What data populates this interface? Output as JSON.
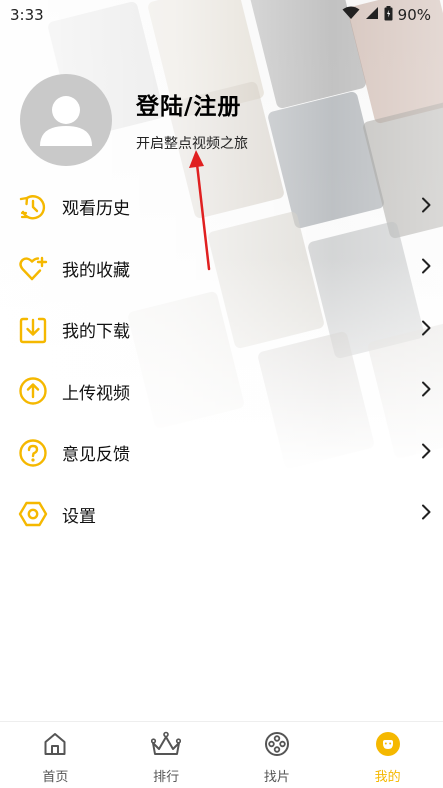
{
  "status_bar": {
    "time": "3:33",
    "battery": "90%"
  },
  "profile": {
    "title": "登陆/注册",
    "subtitle": "开启整点视频之旅"
  },
  "menu": {
    "items": [
      {
        "label": "观看历史",
        "icon": "history-icon"
      },
      {
        "label": "我的收藏",
        "icon": "heart-plus-icon"
      },
      {
        "label": "我的下载",
        "icon": "download-icon"
      },
      {
        "label": "上传视频",
        "icon": "upload-icon"
      },
      {
        "label": "意见反馈",
        "icon": "question-icon"
      },
      {
        "label": "设置",
        "icon": "settings-icon"
      }
    ]
  },
  "tab_bar": {
    "tabs": [
      {
        "label": "首页",
        "icon": "home-icon"
      },
      {
        "label": "排行",
        "icon": "crown-icon"
      },
      {
        "label": "找片",
        "icon": "film-reel-icon"
      },
      {
        "label": "我的",
        "icon": "profile-icon",
        "active": true
      }
    ]
  },
  "colors": {
    "accent": "#f5b800",
    "annotation": "#e02020"
  }
}
